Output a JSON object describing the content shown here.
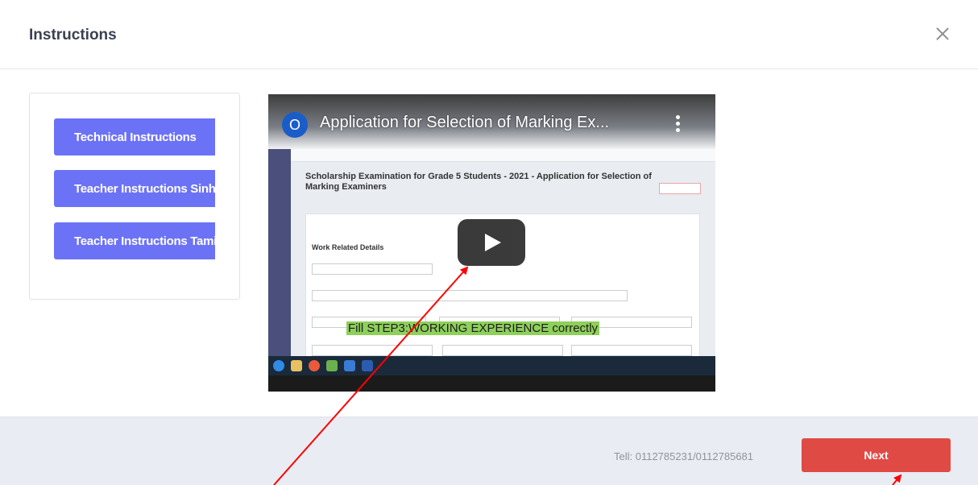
{
  "dialog": {
    "title": "Instructions",
    "close_icon": "close-icon"
  },
  "side_panel": {
    "buttons": [
      {
        "label": "Technical Instructions"
      },
      {
        "label": "Teacher Instructions Sinhala"
      },
      {
        "label": "Teacher Instructions Tamil"
      }
    ]
  },
  "video": {
    "channel_initial": "O",
    "title": "Application for Selection of Marking Ex...",
    "menu_icon": "more-vertical-icon",
    "play_icon": "play-icon",
    "heading": "Scholarship Examination for Grade 5 Students - 2021 - Application for Selection of Marking Examiners",
    "section": "Work Related Details",
    "caption": "Fill STEP3:WORKING EXPERIENCE correctly"
  },
  "footer": {
    "tel": "Tell: 0112785231/0112785681",
    "next_label": "Next"
  },
  "colors": {
    "nav_button": "#6c72f5",
    "next_button": "#e04a45",
    "footer_bg": "#e9ecf3",
    "annotation_arrow": "#ff0000"
  }
}
